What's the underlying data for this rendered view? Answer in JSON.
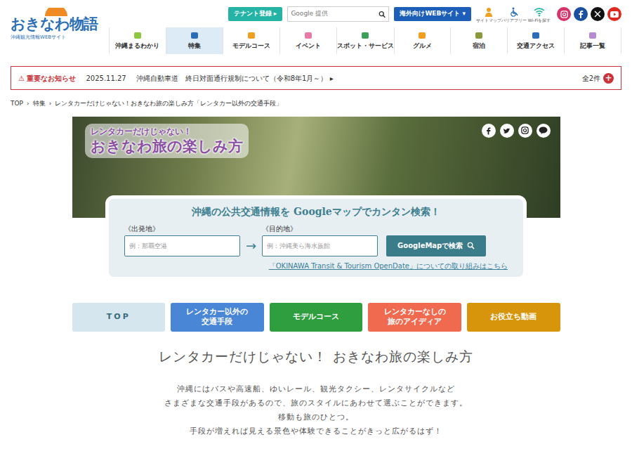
{
  "header": {
    "logo": {
      "title": "おきなわ物語",
      "subtitle": "沖縄観光情報WEBサイト"
    },
    "tenant_button": {
      "label": "テナント登録",
      "icon": "▸"
    },
    "search": {
      "placeholder": "Google 提供"
    },
    "overseas_button": {
      "label": "海外向けWEBサイト",
      "icon": "▾"
    },
    "utilities": [
      "サイトマップ",
      "バリアフリー",
      "Wi-Fiを探す"
    ]
  },
  "nav": [
    {
      "label": "沖縄まるわかり",
      "selected": false
    },
    {
      "label": "特集",
      "selected": true
    },
    {
      "label": "モデルコース",
      "selected": false
    },
    {
      "label": "イベント",
      "selected": false
    },
    {
      "label": "スポット・サービス",
      "selected": false
    },
    {
      "label": "グルメ",
      "selected": false
    },
    {
      "label": "宿泊",
      "selected": false
    },
    {
      "label": "交通アクセス",
      "selected": false
    },
    {
      "label": "記事一覧",
      "selected": false
    }
  ],
  "notice": {
    "icon": "⚠",
    "label": "重要なお知らせ",
    "date": "2025.11.27",
    "text": "沖縄自動車道　終日対面通行規制について（令和8年1月～）",
    "arrow": "▸",
    "count": "全2件",
    "more": "+"
  },
  "breadcrumb": {
    "separator": "›",
    "items": [
      "TOP",
      "特集",
      "レンタカーだけじゃない！おきなわ旅の楽しみ方「レンタカー以外の交通手段」"
    ]
  },
  "hero": {
    "line1": "レンタカーだけじゃない！",
    "line2": "おきなわ旅の楽しみ方"
  },
  "route_search": {
    "title": "沖縄の公共交通情報を Googleマップでカンタン検索！",
    "from_label": "《出発地》",
    "from_placeholder": "例：那覇空港",
    "arrow": "→",
    "to_label": "《目的地》",
    "to_placeholder": "例：沖縄美ら海水族館",
    "button": "GoogleMapで検索",
    "link": "「OKINAWA Transit & Tourism OpenDate」についての取り組みはこちら"
  },
  "tabs": [
    {
      "lines": [
        "TOP"
      ],
      "color": "#d6e6ee",
      "selected": true
    },
    {
      "lines": [
        "レンタカー以外の",
        "交通手段"
      ],
      "color": "#4a86d6",
      "selected": false
    },
    {
      "lines": [
        "モデルコース"
      ],
      "color": "#2e9e3e",
      "selected": false
    },
    {
      "lines": [
        "レンタカーなしの",
        "旅のアイディア"
      ],
      "color": "#ef6a4f",
      "selected": false
    },
    {
      "lines": [
        "お役立ち動画"
      ],
      "color": "#d6950a",
      "selected": false
    }
  ],
  "heading": "レンタカーだけじゃない！ おきなわ旅の楽しみ方",
  "intro": [
    "沖縄にはバスや高速船、ゆいレール、観光タクシー、レンタサイクルなど",
    "さまざまな交通手段があるので、旅のスタイルにあわせて選ぶことができます。",
    "移動も旅のひとつ。",
    "手段が増えれば見える景色や体験できることがきっと広がるはず！"
  ]
}
